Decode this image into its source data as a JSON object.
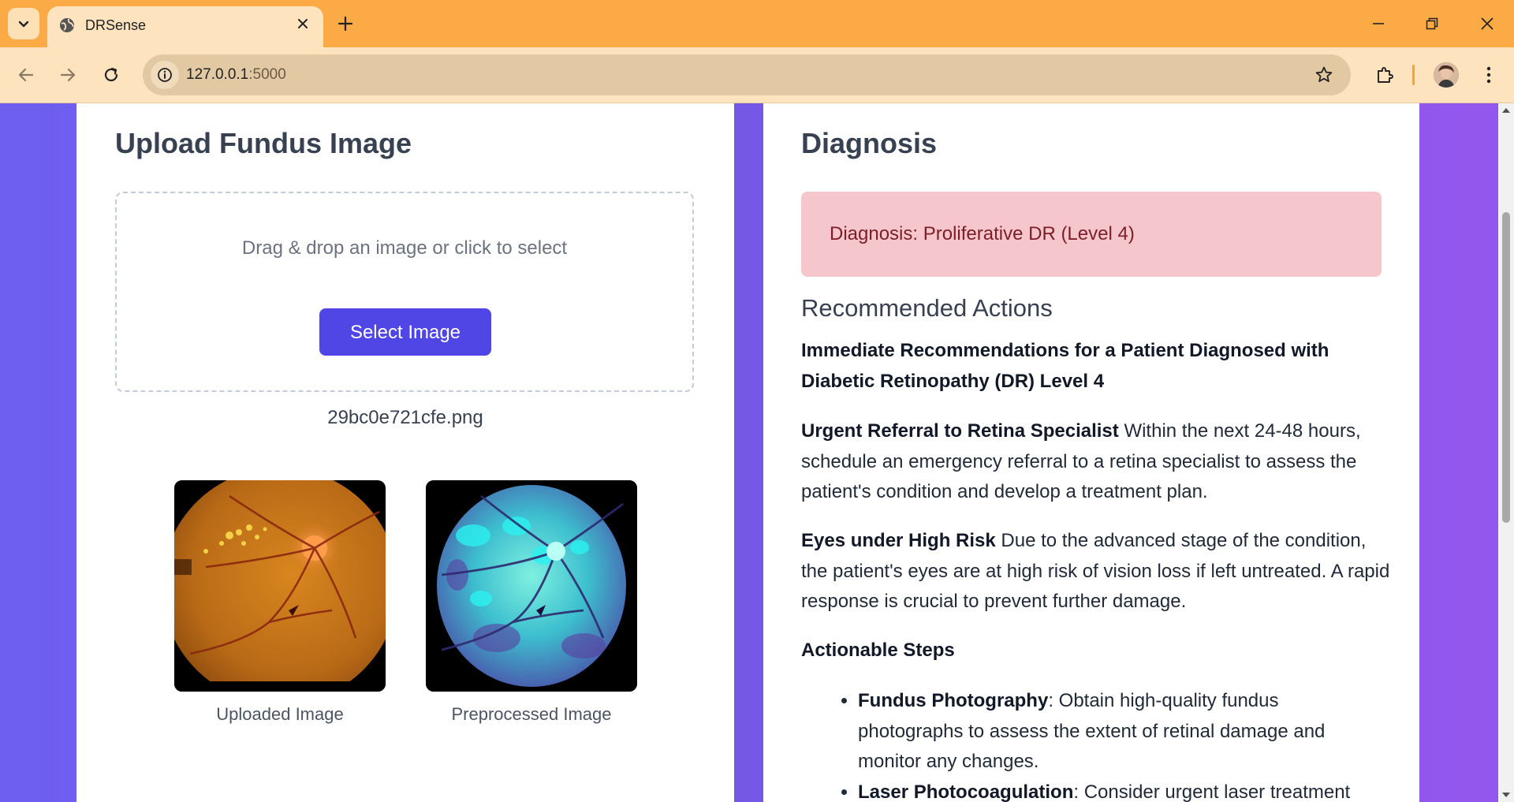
{
  "browser": {
    "tab_title": "DRSense",
    "url_host": "127.0.0.1",
    "url_port": ":5000"
  },
  "upload": {
    "title": "Upload Fundus Image",
    "dropzone_text": "Drag & drop an image or click to select",
    "select_button": "Select Image",
    "filename": "29bc0e721cfe.png",
    "uploaded_caption": "Uploaded Image",
    "preprocessed_caption": "Preprocessed Image"
  },
  "diagnosis": {
    "title": "Diagnosis",
    "result": "Diagnosis: Proliferative DR (Level 4)",
    "actions_title": "Recommended Actions",
    "intro_heading": "Immediate Recommendations for a Patient Diagnosed with Diabetic Retinopathy (DR) Level 4",
    "referral_heading": "Urgent Referral to Retina Specialist",
    "referral_text": " Within the next 24-48 hours, schedule an emergency referral to a retina specialist to assess the patient's condition and develop a treatment plan.",
    "risk_heading": "Eyes under High Risk",
    "risk_text": " Due to the advanced stage of the condition, the patient's eyes are at high risk of vision loss if left untreated. A rapid response is crucial to prevent further damage.",
    "steps_heading": "Actionable Steps",
    "steps": [
      {
        "term": "Fundus Photography",
        "text": ": Obtain high-quality fundus photographs to assess the extent of retinal damage and monitor any changes."
      },
      {
        "term": "Laser Photocoagulation",
        "text": ": Consider urgent laser treatment"
      }
    ]
  },
  "colors": {
    "accent": "#4f46e5",
    "alert_bg": "#f5c6cb",
    "alert_text": "#7c1d27",
    "chrome": "#fbaa45"
  }
}
